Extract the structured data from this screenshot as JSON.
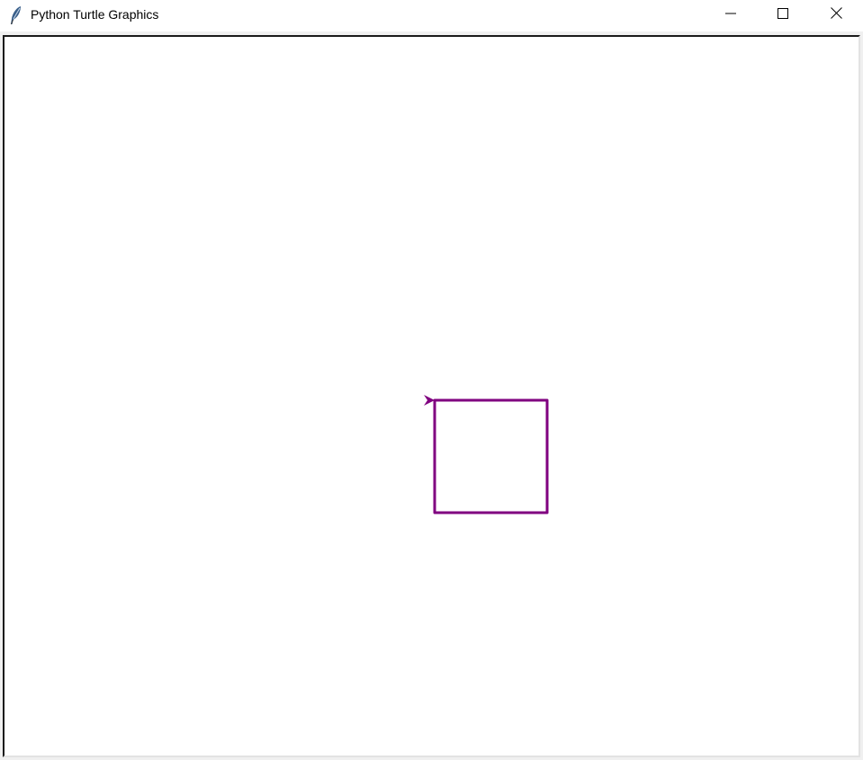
{
  "window": {
    "title": "Python Turtle Graphics",
    "app_icon": "feather-icon",
    "controls": {
      "minimize_icon": "minimize-icon",
      "maximize_icon": "maximize-icon",
      "close_icon": "close-icon"
    }
  },
  "canvas": {
    "background": "#ffffff",
    "drawing": {
      "shape": "square",
      "pen_color": "#800080"
    },
    "turtle": {
      "shape": "arrow",
      "color": "#800080",
      "heading": "east"
    }
  }
}
